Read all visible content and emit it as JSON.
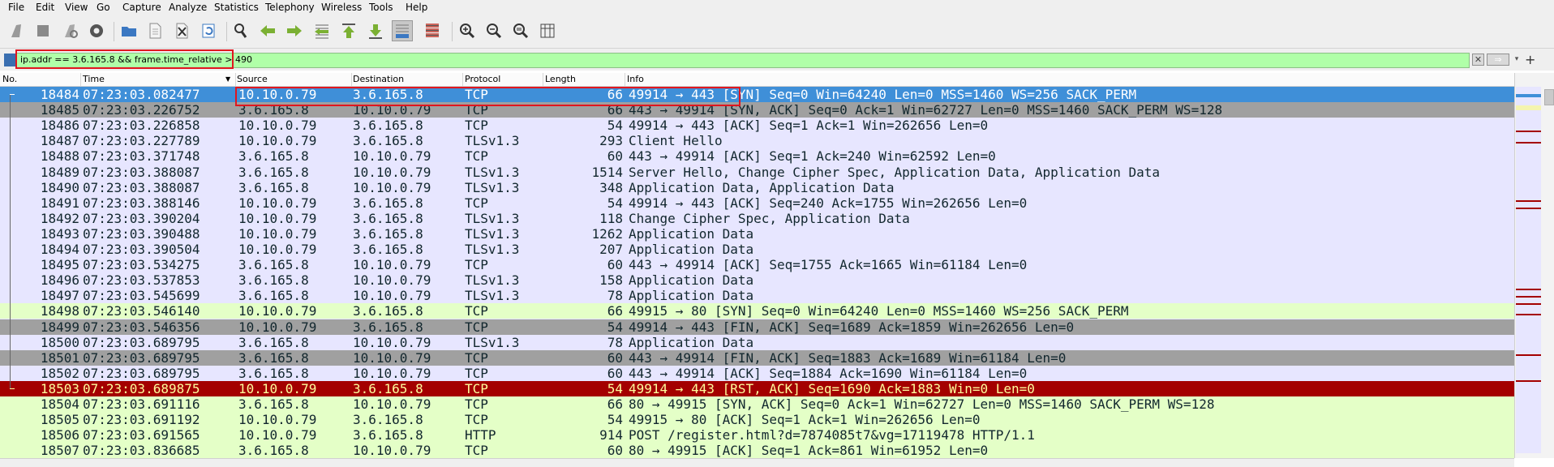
{
  "menu": [
    "File",
    "Edit",
    "View",
    "Go",
    "Capture",
    "Analyze",
    "Statistics",
    "Telephony",
    "Wireless",
    "Tools",
    "Help"
  ],
  "toolbar_icons": [
    "shark-fin-start-icon",
    "stop-square-icon",
    "shark-fin-restart-icon",
    "gear-options-icon",
    "open-folder-icon",
    "file-icon",
    "close-file-icon",
    "reload-icon",
    "find-magnifier-icon",
    "arrow-back-icon",
    "arrow-forward-icon",
    "go-to-packet-icon",
    "go-first-icon",
    "go-last-icon",
    "autoscroll-icon",
    "colorize-icon",
    "zoom-in-icon",
    "zoom-out-icon",
    "zoom-normal-icon",
    "resize-columns-icon"
  ],
  "filter": {
    "value": "ip.addr == 3.6.165.8 && frame.time_relative > 490",
    "background": "#b0ffa8"
  },
  "columns": [
    "No.",
    "Time",
    "Source",
    "Destination",
    "Protocol",
    "Length",
    "Info"
  ],
  "colors": {
    "default": "#e7e6ff",
    "selected": "#3f8fd8",
    "grey": "#a0a0a0",
    "green": "#e4ffc7",
    "red": "#a40000",
    "highlight_box": "#e0161f"
  },
  "packets": [
    {
      "no": "18484",
      "time": "07:23:03.082477",
      "src": "10.10.0.79",
      "dst": "3.6.165.8",
      "proto": "TCP",
      "len": "66",
      "info": "49914 → 443 [SYN] Seq=0 Win=64240 Len=0 MSS=1460 WS=256 SACK_PERM",
      "style": "selected"
    },
    {
      "no": "18485",
      "time": "07:23:03.226752",
      "src": "3.6.165.8",
      "dst": "10.10.0.79",
      "proto": "TCP",
      "len": "66",
      "info": "443 → 49914 [SYN, ACK] Seq=0 Ack=1 Win=62727 Len=0 MSS=1460 SACK_PERM WS=128",
      "style": "grey"
    },
    {
      "no": "18486",
      "time": "07:23:03.226858",
      "src": "10.10.0.79",
      "dst": "3.6.165.8",
      "proto": "TCP",
      "len": "54",
      "info": "49914 → 443 [ACK] Seq=1 Ack=1 Win=262656 Len=0",
      "style": "default"
    },
    {
      "no": "18487",
      "time": "07:23:03.227789",
      "src": "10.10.0.79",
      "dst": "3.6.165.8",
      "proto": "TLSv1.3",
      "len": "293",
      "info": "Client Hello",
      "style": "default"
    },
    {
      "no": "18488",
      "time": "07:23:03.371748",
      "src": "3.6.165.8",
      "dst": "10.10.0.79",
      "proto": "TCP",
      "len": "60",
      "info": "443 → 49914 [ACK] Seq=1 Ack=240 Win=62592 Len=0",
      "style": "default"
    },
    {
      "no": "18489",
      "time": "07:23:03.388087",
      "src": "3.6.165.8",
      "dst": "10.10.0.79",
      "proto": "TLSv1.3",
      "len": "1514",
      "info": "Server Hello, Change Cipher Spec, Application Data, Application Data",
      "style": "default"
    },
    {
      "no": "18490",
      "time": "07:23:03.388087",
      "src": "3.6.165.8",
      "dst": "10.10.0.79",
      "proto": "TLSv1.3",
      "len": "348",
      "info": "Application Data, Application Data",
      "style": "default"
    },
    {
      "no": "18491",
      "time": "07:23:03.388146",
      "src": "10.10.0.79",
      "dst": "3.6.165.8",
      "proto": "TCP",
      "len": "54",
      "info": "49914 → 443 [ACK] Seq=240 Ack=1755 Win=262656 Len=0",
      "style": "default"
    },
    {
      "no": "18492",
      "time": "07:23:03.390204",
      "src": "10.10.0.79",
      "dst": "3.6.165.8",
      "proto": "TLSv1.3",
      "len": "118",
      "info": "Change Cipher Spec, Application Data",
      "style": "default"
    },
    {
      "no": "18493",
      "time": "07:23:03.390488",
      "src": "10.10.0.79",
      "dst": "3.6.165.8",
      "proto": "TLSv1.3",
      "len": "1262",
      "info": "Application Data",
      "style": "default"
    },
    {
      "no": "18494",
      "time": "07:23:03.390504",
      "src": "10.10.0.79",
      "dst": "3.6.165.8",
      "proto": "TLSv1.3",
      "len": "207",
      "info": "Application Data",
      "style": "default"
    },
    {
      "no": "18495",
      "time": "07:23:03.534275",
      "src": "3.6.165.8",
      "dst": "10.10.0.79",
      "proto": "TCP",
      "len": "60",
      "info": "443 → 49914 [ACK] Seq=1755 Ack=1665 Win=61184 Len=0",
      "style": "default"
    },
    {
      "no": "18496",
      "time": "07:23:03.537853",
      "src": "3.6.165.8",
      "dst": "10.10.0.79",
      "proto": "TLSv1.3",
      "len": "158",
      "info": "Application Data",
      "style": "default"
    },
    {
      "no": "18497",
      "time": "07:23:03.545699",
      "src": "3.6.165.8",
      "dst": "10.10.0.79",
      "proto": "TLSv1.3",
      "len": "78",
      "info": "Application Data",
      "style": "default"
    },
    {
      "no": "18498",
      "time": "07:23:03.546140",
      "src": "10.10.0.79",
      "dst": "3.6.165.8",
      "proto": "TCP",
      "len": "66",
      "info": "49915 → 80 [SYN] Seq=0 Win=64240 Len=0 MSS=1460 WS=256 SACK_PERM",
      "style": "green"
    },
    {
      "no": "18499",
      "time": "07:23:03.546356",
      "src": "10.10.0.79",
      "dst": "3.6.165.8",
      "proto": "TCP",
      "len": "54",
      "info": "49914 → 443 [FIN, ACK] Seq=1689 Ack=1859 Win=262656 Len=0",
      "style": "grey"
    },
    {
      "no": "18500",
      "time": "07:23:03.689795",
      "src": "3.6.165.8",
      "dst": "10.10.0.79",
      "proto": "TLSv1.3",
      "len": "78",
      "info": "Application Data",
      "style": "default"
    },
    {
      "no": "18501",
      "time": "07:23:03.689795",
      "src": "3.6.165.8",
      "dst": "10.10.0.79",
      "proto": "TCP",
      "len": "60",
      "info": "443 → 49914 [FIN, ACK] Seq=1883 Ack=1689 Win=61184 Len=0",
      "style": "grey"
    },
    {
      "no": "18502",
      "time": "07:23:03.689795",
      "src": "3.6.165.8",
      "dst": "10.10.0.79",
      "proto": "TCP",
      "len": "60",
      "info": "443 → 49914 [ACK] Seq=1884 Ack=1690 Win=61184 Len=0",
      "style": "default"
    },
    {
      "no": "18503",
      "time": "07:23:03.689875",
      "src": "10.10.0.79",
      "dst": "3.6.165.8",
      "proto": "TCP",
      "len": "54",
      "info": "49914 → 443 [RST, ACK] Seq=1690 Ack=1883 Win=0 Len=0",
      "style": "red"
    },
    {
      "no": "18504",
      "time": "07:23:03.691116",
      "src": "3.6.165.8",
      "dst": "10.10.0.79",
      "proto": "TCP",
      "len": "66",
      "info": "80 → 49915 [SYN, ACK] Seq=0 Ack=1 Win=62727 Len=0 MSS=1460 SACK_PERM WS=128",
      "style": "green"
    },
    {
      "no": "18505",
      "time": "07:23:03.691192",
      "src": "10.10.0.79",
      "dst": "3.6.165.8",
      "proto": "TCP",
      "len": "54",
      "info": "49915 → 80 [ACK] Seq=1 Ack=1 Win=262656 Len=0",
      "style": "green"
    },
    {
      "no": "18506",
      "time": "07:23:03.691565",
      "src": "10.10.0.79",
      "dst": "3.6.165.8",
      "proto": "HTTP",
      "len": "914",
      "info": "POST /register.html?d=7874085t7&vg=17119478 HTTP/1.1",
      "style": "green"
    },
    {
      "no": "18507",
      "time": "07:23:03.836685",
      "src": "3.6.165.8",
      "dst": "10.10.0.79",
      "proto": "TCP",
      "len": "60",
      "info": "80 → 49915 [ACK] Seq=1 Ack=861 Win=61952 Len=0",
      "style": "green"
    }
  ]
}
